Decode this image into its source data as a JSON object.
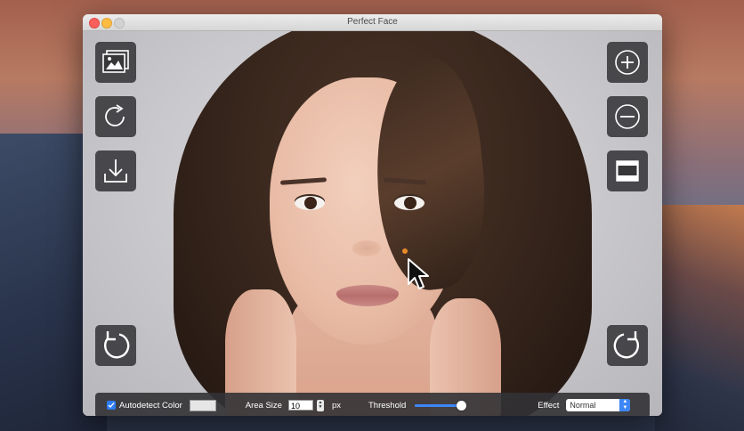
{
  "window": {
    "title": "Perfect Face"
  },
  "toolbar_left": [
    {
      "icon": "image-icon",
      "action": "open-image"
    },
    {
      "icon": "rotate-icon",
      "action": "rotate"
    },
    {
      "icon": "download-icon",
      "action": "save"
    },
    {
      "icon": "undo-icon",
      "action": "undo"
    }
  ],
  "toolbar_right": [
    {
      "icon": "zoom-in-icon",
      "action": "zoom-in"
    },
    {
      "icon": "zoom-out-icon",
      "action": "zoom-out"
    },
    {
      "icon": "split-view-icon",
      "action": "compare"
    },
    {
      "icon": "redo-icon",
      "action": "redo"
    }
  ],
  "bottom_bar": {
    "autodetect_label": "Autodetect Color",
    "autodetect_checked": true,
    "area_size_label": "Area Size",
    "area_size_value": "10",
    "area_size_unit": "px",
    "threshold_label": "Threshold",
    "threshold_value": 0.95,
    "effect_label": "Effect",
    "effect_value": "Normal"
  },
  "colors": {
    "accent": "#3d86f6",
    "toolbar_bg": "#37373a",
    "marker_dot": "#e8892a"
  }
}
